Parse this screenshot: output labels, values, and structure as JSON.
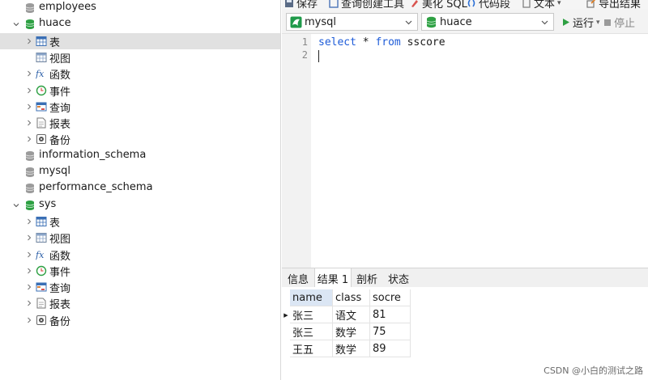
{
  "tree": [
    {
      "label": "employees",
      "icon": "database-gray-icon",
      "level": 1,
      "chevron": "none",
      "selected": false
    },
    {
      "label": "huace",
      "icon": "database-green-icon",
      "level": 1,
      "chevron": "down",
      "selected": false
    },
    {
      "label": "表",
      "icon": "table-icon",
      "level": 2,
      "chevron": "right",
      "selected": true
    },
    {
      "label": "视图",
      "icon": "view-icon",
      "level": 2,
      "chevron": "none",
      "selected": false
    },
    {
      "label": "函数",
      "icon": "function-icon",
      "level": 2,
      "chevron": "right",
      "selected": false
    },
    {
      "label": "事件",
      "icon": "event-clock-icon",
      "level": 2,
      "chevron": "right",
      "selected": false
    },
    {
      "label": "查询",
      "icon": "query-icon",
      "level": 2,
      "chevron": "right",
      "selected": false
    },
    {
      "label": "报表",
      "icon": "report-icon",
      "level": 2,
      "chevron": "right",
      "selected": false
    },
    {
      "label": "备份",
      "icon": "backup-icon",
      "level": 2,
      "chevron": "right",
      "selected": false
    },
    {
      "label": "information_schema",
      "icon": "database-gray-icon",
      "level": 1,
      "chevron": "none",
      "selected": false
    },
    {
      "label": "mysql",
      "icon": "database-gray-icon",
      "level": 1,
      "chevron": "none",
      "selected": false
    },
    {
      "label": "performance_schema",
      "icon": "database-gray-icon",
      "level": 1,
      "chevron": "none",
      "selected": false
    },
    {
      "label": "sys",
      "icon": "database-green-icon",
      "level": 1,
      "chevron": "down",
      "selected": false
    },
    {
      "label": "表",
      "icon": "table-icon",
      "level": 2,
      "chevron": "right",
      "selected": false
    },
    {
      "label": "视图",
      "icon": "view-icon",
      "level": 2,
      "chevron": "right",
      "selected": false
    },
    {
      "label": "函数",
      "icon": "function-icon",
      "level": 2,
      "chevron": "right",
      "selected": false
    },
    {
      "label": "事件",
      "icon": "event-clock-icon",
      "level": 2,
      "chevron": "right",
      "selected": false
    },
    {
      "label": "查询",
      "icon": "query-icon",
      "level": 2,
      "chevron": "right",
      "selected": false
    },
    {
      "label": "报表",
      "icon": "report-icon",
      "level": 2,
      "chevron": "right",
      "selected": false
    },
    {
      "label": "备份",
      "icon": "backup-icon",
      "level": 2,
      "chevron": "right",
      "selected": false
    }
  ],
  "toolbar": {
    "save": "保存",
    "query_builder": "查询创建工具",
    "beautify_sql": "美化 SQL",
    "code_snippet": "代码段",
    "text": "文本",
    "export_result": "导出结果"
  },
  "connection_combo": {
    "value": "mysql",
    "icon": "mysql-connection-icon"
  },
  "database_combo": {
    "value": "huace",
    "icon": "database-green-icon"
  },
  "run": {
    "label": "运行",
    "stop_label": "停止"
  },
  "editor": {
    "lines": [
      "1",
      "2"
    ],
    "code": {
      "kw1": "select",
      "t1": " * ",
      "kw2": "from",
      "t2": " sscore"
    }
  },
  "tabs": [
    "信息",
    "结果 1",
    "剖析",
    "状态"
  ],
  "active_tab": 1,
  "grid": {
    "columns": [
      "name",
      "class",
      "socre"
    ],
    "rows": [
      [
        "张三",
        "语文",
        "81"
      ],
      [
        "张三",
        "数学",
        "75"
      ],
      [
        "王五",
        "数学",
        "89"
      ]
    ]
  },
  "watermark": "CSDN @小白的测试之路",
  "colors": {
    "keyword": "#1d5bd8",
    "db_green": "#2ea043",
    "selected_row": "#e1e1e1",
    "header_highlight": "#dbe6f4"
  }
}
